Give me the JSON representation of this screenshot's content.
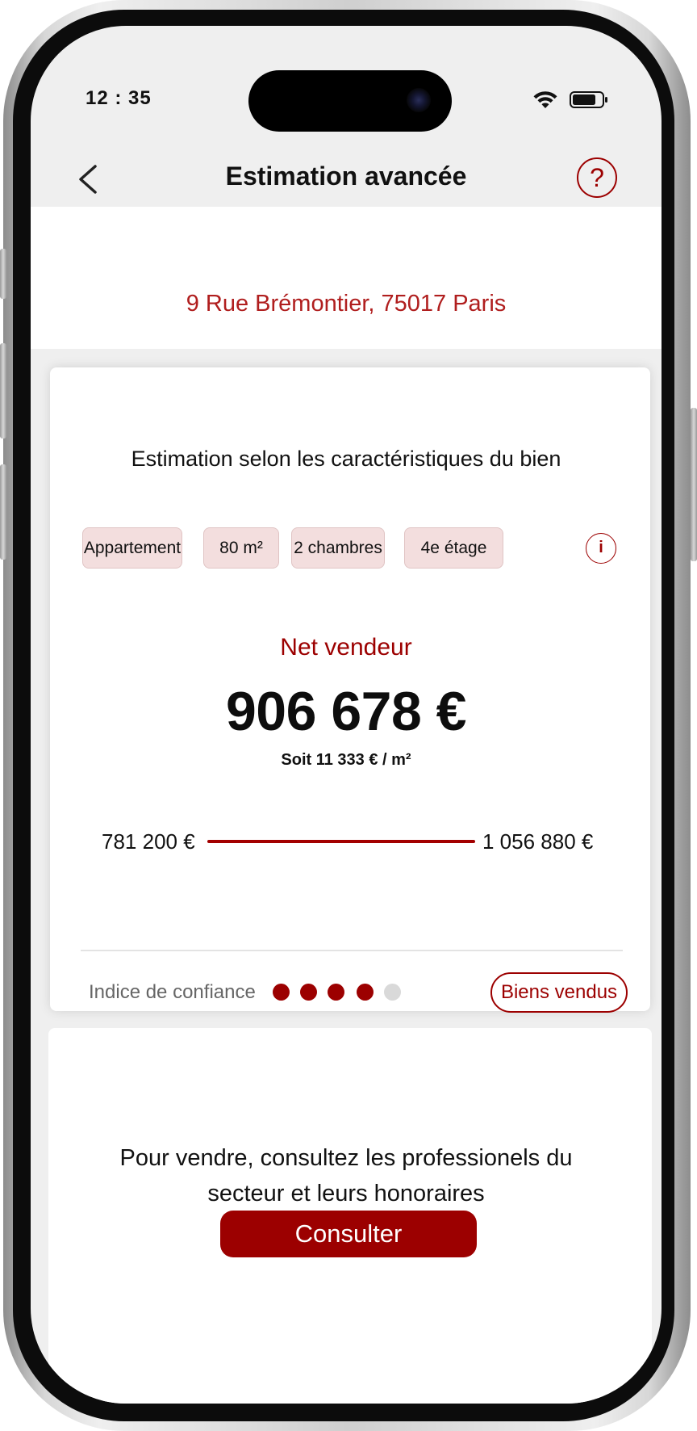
{
  "status_bar": {
    "time": "12 : 35",
    "wifi_icon": "wifi-icon",
    "battery_icon": "battery-icon"
  },
  "header": {
    "title": "Estimation avancée",
    "back_icon": "chevron-left-icon",
    "help_label": "?"
  },
  "address": "9 Rue Brémontier, 75017 Paris",
  "estimate": {
    "heading": "Estimation selon les caractéristiques du bien",
    "chips": [
      "Appartement",
      "80 m²",
      "2 chambres",
      "4e étage"
    ],
    "info_label": "i",
    "net_label": "Net vendeur",
    "price": "906 678 €",
    "price_per_m2": "Soit 11 333 € / m²",
    "range_min": "781 200 €",
    "range_max": "1 056 880 €",
    "confidence_label": "Indice de confiance",
    "confidence_level": 4,
    "confidence_max": 5,
    "sold_button": "Biens vendus"
  },
  "sell": {
    "text": "Pour vendre, consultez les professionels du secteur et leurs honoraires",
    "button": "Consulter"
  },
  "colors": {
    "accent": "#9c0000",
    "address": "#b01e1e",
    "chip_bg": "#f3dede",
    "dot_inactive": "#d9d9d9",
    "screen_bg": "#efefef"
  }
}
